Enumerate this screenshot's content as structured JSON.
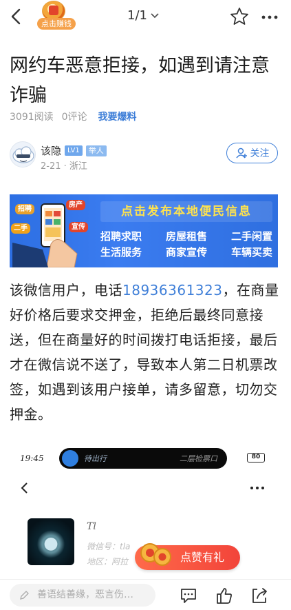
{
  "topbar": {
    "badge_label": "点击赚钱",
    "pager": "1/1"
  },
  "article": {
    "title": "网约车恶意拒接，如遇到请注意诈骗",
    "reads": "3091阅读",
    "comments": "0评论",
    "tip_link": "我要爆料"
  },
  "author": {
    "name": "该隐",
    "level": "LV1",
    "tag": "举人",
    "date_location": "2-21 · 浙江",
    "follow_label": "关注"
  },
  "banner": {
    "headline": "点击发布本地便民信息",
    "row1": [
      "招聘求职",
      "房屋租售",
      "二手闲置"
    ],
    "row2": [
      "生活服务",
      "商家宣传",
      "车辆买卖"
    ],
    "chips": [
      "招聘",
      "房产",
      "二手",
      "宣传"
    ]
  },
  "body": {
    "part1": "该微信用户，电话",
    "phone": "18936361323",
    "part2": "，在商量好价格后要求交押金，拒绝后最终同意接送，但在商量好的时间拨打电话拒接，最后才在微信说不送了，导致本人第二日机票改签，如遇到该用户接单，请多留意，切勿交押金。"
  },
  "screenshot": {
    "time": "19:45",
    "pill_left": "待出行",
    "pill_right": "二层检票口",
    "battery": "80",
    "contact_name": "Tl",
    "wechat_id": "微信号：tla",
    "area": "地区：阿拉"
  },
  "like_button": "点赞有礼",
  "bottombar": {
    "comment_placeholder": "善语结善缘，恶言伤…"
  },
  "colors": {
    "accent": "#3f7fd8",
    "like": "#f2443a",
    "banner": "#2d6fe3"
  }
}
